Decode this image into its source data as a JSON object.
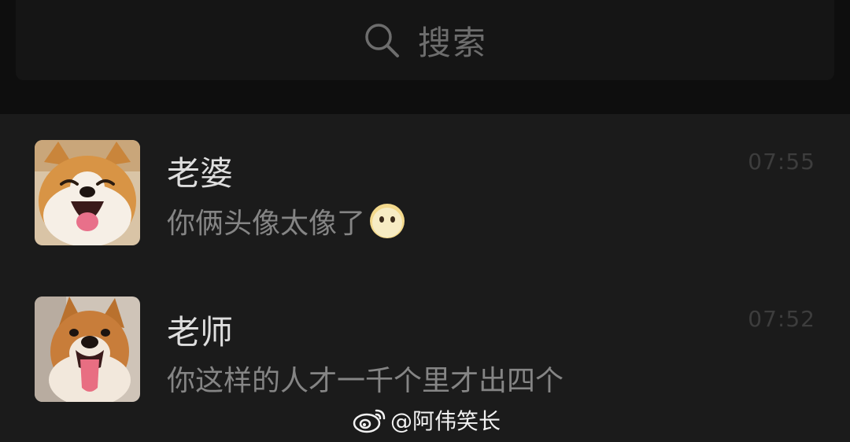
{
  "search": {
    "label": "搜索",
    "icon": "search-icon"
  },
  "chats": [
    {
      "name": "老婆",
      "message": "你俩头像太像了",
      "emoji": "speechless-face-emoji",
      "time": "07:55",
      "avatar": "shiba-dog-smiling"
    },
    {
      "name": "老师",
      "message": "你这样的人才一千个里才出四个",
      "time": "07:52",
      "avatar": "shiba-dog-tongue-out"
    }
  ],
  "watermark": {
    "text": "@阿伟笑长",
    "icon": "weibo-logo-icon"
  },
  "colors": {
    "background": "#1b1b1b",
    "header_background": "#0e0e0e",
    "search_bar": "#151515",
    "name_text": "#dedede",
    "message_text": "#858585",
    "time_text": "#3d3d3d"
  }
}
